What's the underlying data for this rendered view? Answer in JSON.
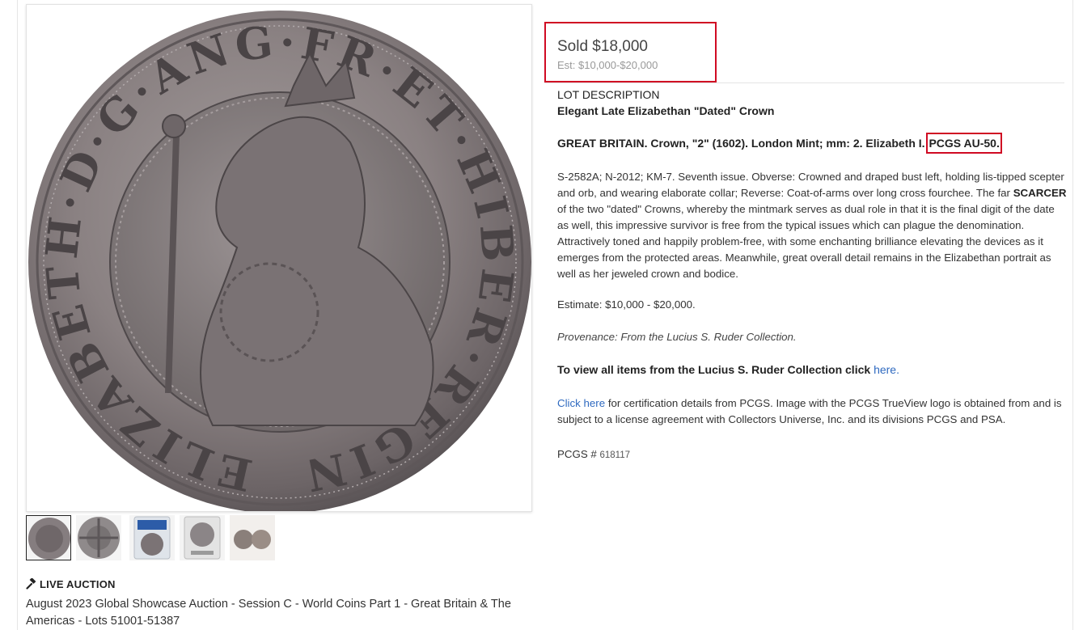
{
  "main_image": {
    "legend_text": "ELIZABETH·D·G·ANG·FR·ET·HIBER·REGINA· 2"
  },
  "thumbnails": [
    {
      "name": "obverse",
      "active": true
    },
    {
      "name": "reverse",
      "active": false
    },
    {
      "name": "slab-front",
      "active": false
    },
    {
      "name": "slab-back",
      "active": false
    },
    {
      "name": "pair",
      "active": false
    }
  ],
  "auction": {
    "live_label": "LIVE AUCTION",
    "title": "August 2023 Global Showcase Auction - Session C - World Coins Part 1 - Great Britain & The Americas - Lots 51001-51387"
  },
  "lot": {
    "sold": "Sold $18,000",
    "estimate_range": "Est: $10,000-$20,000",
    "description_heading": "LOT DESCRIPTION",
    "title": "Elegant Late Elizabethan \"Dated\" Crown",
    "heading_line": "GREAT BRITAIN. Crown, \"2\" (1602). London Mint; mm: 2. Elizabeth I.",
    "grade": "PCGS AU-50.",
    "desc_part1": "S-2582A; N-2012; KM-7. Seventh issue. Obverse: Crowned and draped bust left, holding lis-tipped scepter and orb, and wearing elaborate collar; Reverse: Coat-of-arms over long cross fourchee. The far",
    "desc_bold": "SCARCER",
    "desc_part2": "of the two \"dated\" Crowns, whereby the mintmark serves as dual role in that it is the final digit of the date as well, this impressive survivor is free from the typical issues which can plague the denomination. Attractively toned and happily problem-free, with some enchanting brilliance elevating the devices as it emerges from the protected areas. Meanwhile, great overall detail remains in the Elizabethan portrait as well as her jeweled crown and bodice.",
    "estimate_line": "Estimate: $10,000 - $20,000.",
    "provenance": "Provenance: From the Lucius S. Ruder Collection.",
    "collection_text": "To view all items from the Lucius S. Ruder Collection click",
    "collection_link": "here.",
    "cert_link": "Click here",
    "cert_text": "for certification details from PCGS. Image with the PCGS TrueView logo is obtained from and is subject to a license agreement with Collectors Universe, Inc. and its divisions PCGS and PSA.",
    "pcgs_label": "PCGS #",
    "pcgs_number": "618117"
  },
  "colors": {
    "highlight": "#d00a23",
    "link": "#2f6ac0"
  },
  "icons": {
    "gavel": "gavel-icon"
  }
}
